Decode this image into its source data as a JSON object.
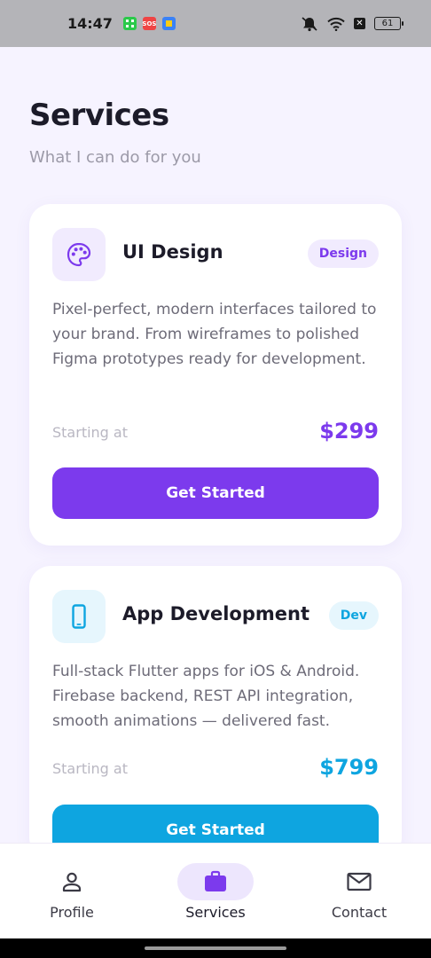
{
  "status_bar": {
    "time": "14:47",
    "battery": "61",
    "icons": [
      "grid-app-icon",
      "sos-app-icon",
      "files-app-icon",
      "mute-icon",
      "wifi-icon",
      "close-box-icon",
      "battery-icon"
    ],
    "sos_text": "SOS"
  },
  "header": {
    "title": "Services",
    "subtitle": "What I can do for you"
  },
  "services": [
    {
      "icon": "palette-icon",
      "title": "UI Design",
      "badge": "Design",
      "description": "Pixel-perfect, modern interfaces tailored to your brand. From wireframes to polished Figma prototypes ready for development.",
      "price_label": "Starting at",
      "price": "$299",
      "cta": "Get Started",
      "accent": "#7c3aed",
      "accent_light": "#f1ebfe"
    },
    {
      "icon": "phone-icon",
      "title": "App Development",
      "badge": "Dev",
      "description": "Full-stack Flutter apps for iOS & Android. Firebase backend, REST API integration, smooth animations — delivered fast.",
      "price_label": "Starting at",
      "price": "$799",
      "cta": "Get Started",
      "accent": "#0ea5e0",
      "accent_light": "#e6f6fd"
    }
  ],
  "bottom_nav": {
    "items": [
      {
        "label": "Profile",
        "icon": "person-icon",
        "active": false
      },
      {
        "label": "Services",
        "icon": "briefcase-icon",
        "active": true
      },
      {
        "label": "Contact",
        "icon": "mail-icon",
        "active": false
      }
    ]
  },
  "colors": {
    "background": "#f6f3ff",
    "primary": "#7c3aed",
    "secondary": "#0ea5e0"
  }
}
